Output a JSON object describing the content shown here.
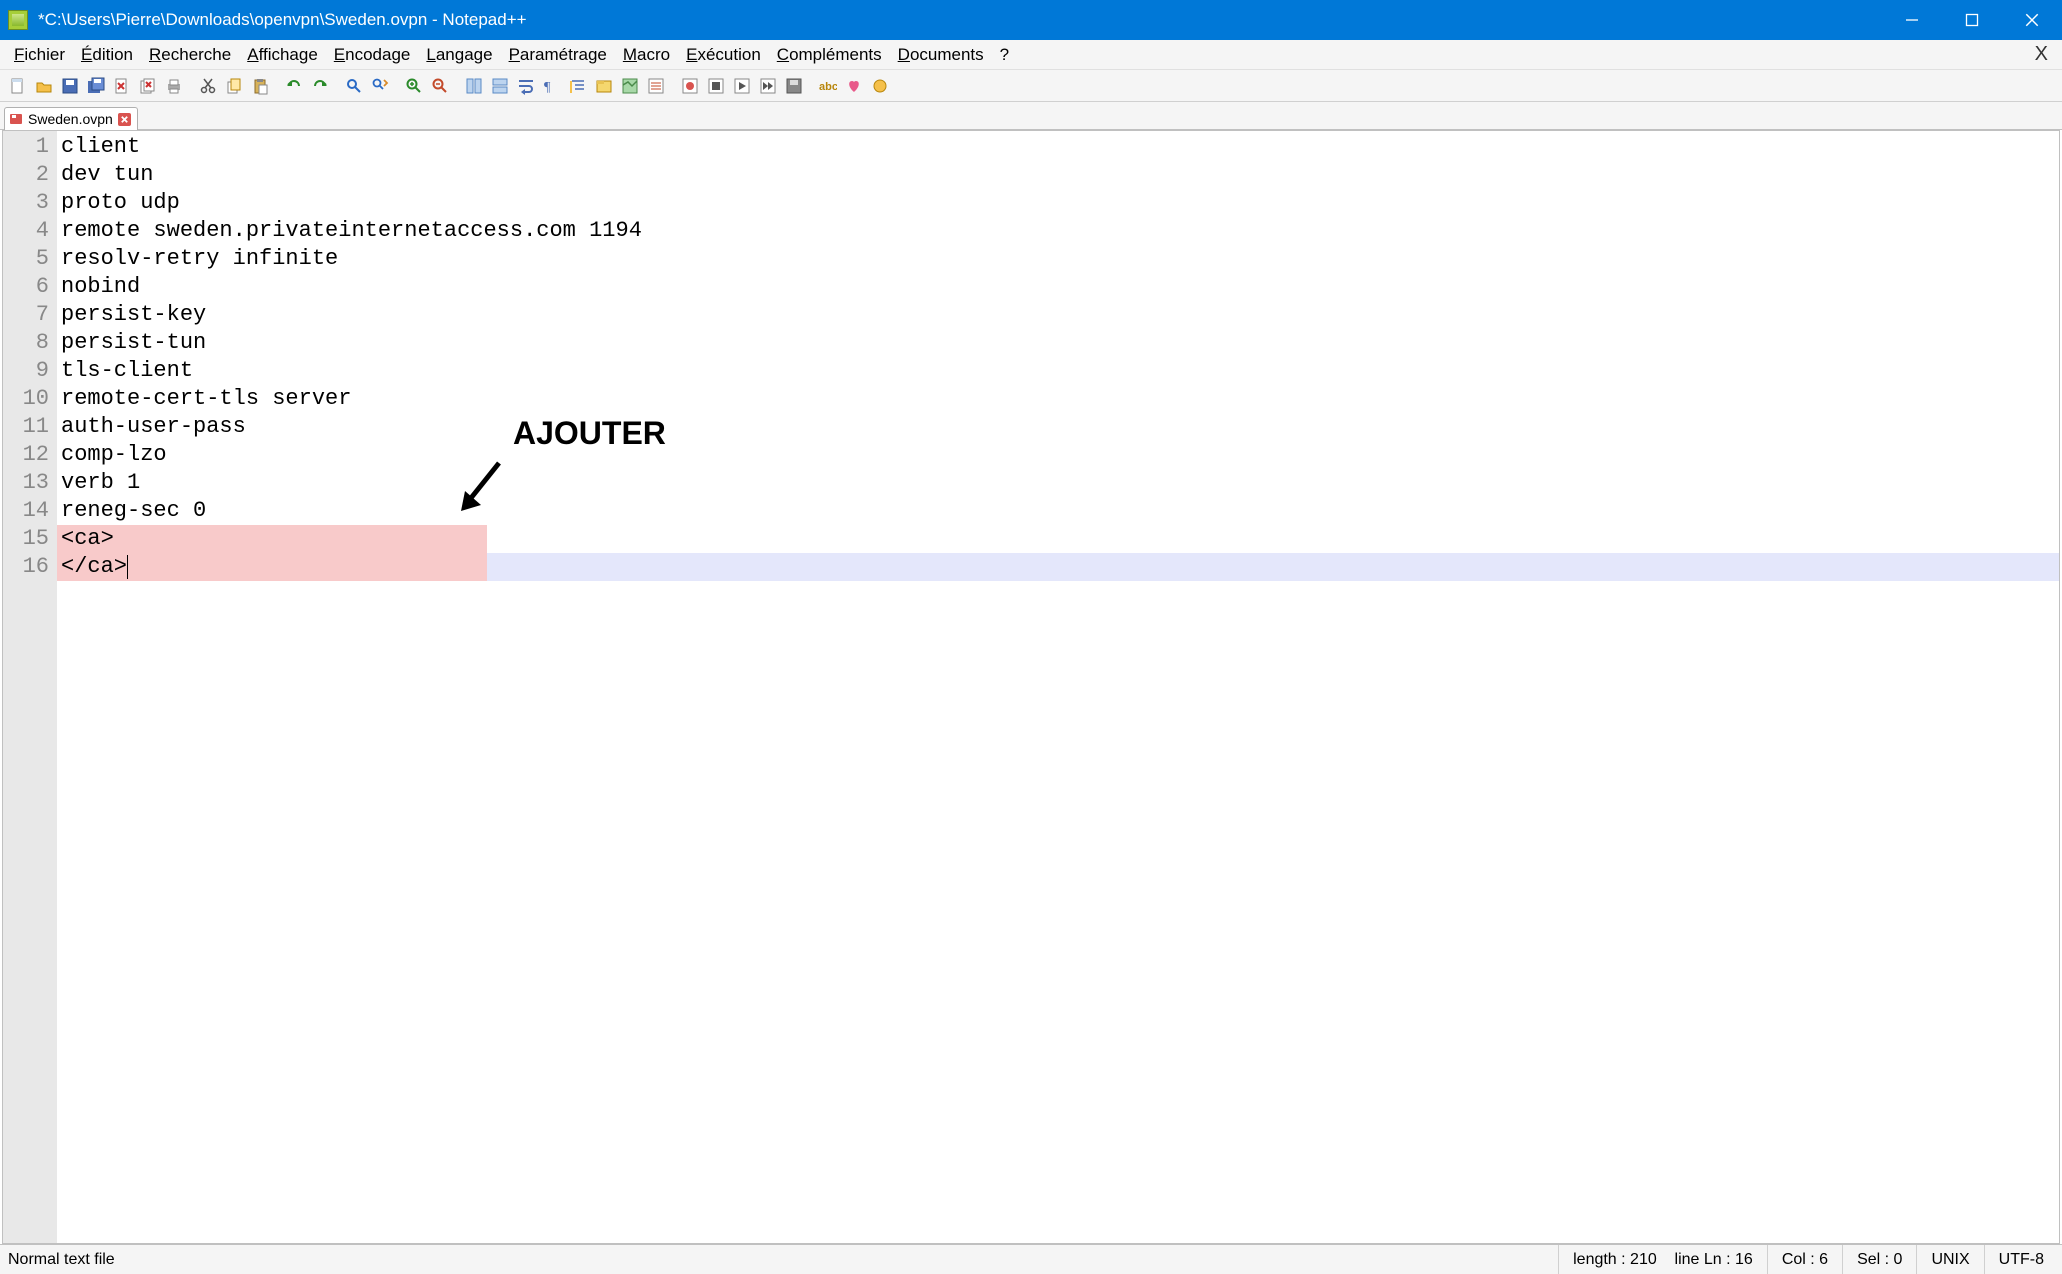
{
  "window": {
    "title": "*C:\\Users\\Pierre\\Downloads\\openvpn\\Sweden.ovpn - Notepad++"
  },
  "menu": {
    "items": [
      {
        "label": "Fichier",
        "accel": "F"
      },
      {
        "label": "Édition",
        "accel": "É"
      },
      {
        "label": "Recherche",
        "accel": "R"
      },
      {
        "label": "Affichage",
        "accel": "A"
      },
      {
        "label": "Encodage",
        "accel": "E"
      },
      {
        "label": "Langage",
        "accel": "L"
      },
      {
        "label": "Paramétrage",
        "accel": "P"
      },
      {
        "label": "Macro",
        "accel": "M"
      },
      {
        "label": "Exécution",
        "accel": "E"
      },
      {
        "label": "Compléments",
        "accel": "C"
      },
      {
        "label": "Documents",
        "accel": "D"
      },
      {
        "label": "?",
        "accel": "?"
      }
    ],
    "close_x": "X"
  },
  "toolbar_icons": [
    "new-file",
    "open-file",
    "save",
    "save-all",
    "close",
    "close-all",
    "print",
    "sep",
    "cut",
    "copy",
    "paste",
    "sep",
    "undo",
    "redo",
    "sep",
    "find",
    "replace",
    "sep",
    "zoom-in",
    "zoom-out",
    "sep",
    "sync-v",
    "sync-h",
    "wrap",
    "show-all",
    "indent-guide",
    "folder",
    "doc-map",
    "func-list",
    "sep",
    "record",
    "stop",
    "play",
    "play-multi",
    "save-macro",
    "sep",
    "spell",
    "heart",
    "donate"
  ],
  "tab": {
    "label": "Sweden.ovpn",
    "modified": true
  },
  "code_lines": [
    {
      "n": 1,
      "text": "client"
    },
    {
      "n": 2,
      "text": "dev tun"
    },
    {
      "n": 3,
      "text": "proto udp"
    },
    {
      "n": 4,
      "text": "remote sweden.privateinternetaccess.com 1194"
    },
    {
      "n": 5,
      "text": "resolv-retry infinite"
    },
    {
      "n": 6,
      "text": "nobind"
    },
    {
      "n": 7,
      "text": "persist-key"
    },
    {
      "n": 8,
      "text": "persist-tun"
    },
    {
      "n": 9,
      "text": "tls-client"
    },
    {
      "n": 10,
      "text": "remote-cert-tls server"
    },
    {
      "n": 11,
      "text": "auth-user-pass"
    },
    {
      "n": 12,
      "text": "comp-lzo"
    },
    {
      "n": 13,
      "text": "verb 1"
    },
    {
      "n": 14,
      "text": "reneg-sec 0"
    },
    {
      "n": 15,
      "text": "<ca>",
      "highlight": "pink"
    },
    {
      "n": 16,
      "text": "</ca>",
      "highlight": "current",
      "cursor_col": 6
    }
  ],
  "annotation": {
    "label": "AJOUTER"
  },
  "status": {
    "left": "Normal text file",
    "length_label": "length : ",
    "length": "210",
    "line_label": "line Ln : ",
    "line": "16",
    "col_label": "Col : ",
    "col": "6",
    "sel_label": "Sel : ",
    "sel": "0",
    "eol": "UNIX",
    "encoding": "UTF-8"
  }
}
